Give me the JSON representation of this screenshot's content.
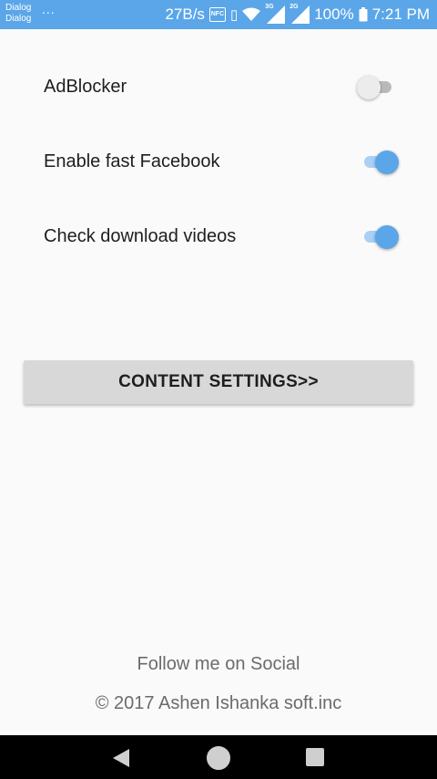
{
  "status_bar": {
    "carrier_line1": "Dialog",
    "carrier_line2": "Dialog",
    "more": "...",
    "net_speed": "27B/s",
    "nfc_label": "NFC",
    "net_type_1": "3G",
    "net_type_2": "2G",
    "battery": "100%",
    "time": "7:21 PM",
    "icons": [
      "nfc-icon",
      "vibrate-icon",
      "wifi-icon",
      "signal-icon",
      "signal-icon",
      "battery-icon"
    ],
    "background_color": "#5aa6e8"
  },
  "settings": [
    {
      "label": "AdBlocker",
      "enabled": false
    },
    {
      "label": "Enable fast Facebook",
      "enabled": true
    },
    {
      "label": "Check download videos",
      "enabled": true
    }
  ],
  "content_settings_button": {
    "label": "CONTENT SETTINGS>>"
  },
  "footer": {
    "follow": "Follow me on Social",
    "copyright": "© 2017 Ashen Ishanka soft.inc"
  },
  "nav_bar": {
    "icons": [
      "back-icon",
      "home-icon",
      "recent-apps-icon"
    ]
  },
  "colors": {
    "accent": "#5aa6e8",
    "accent_track": "#a9d0f5",
    "button_bg": "#d8d8d8"
  }
}
